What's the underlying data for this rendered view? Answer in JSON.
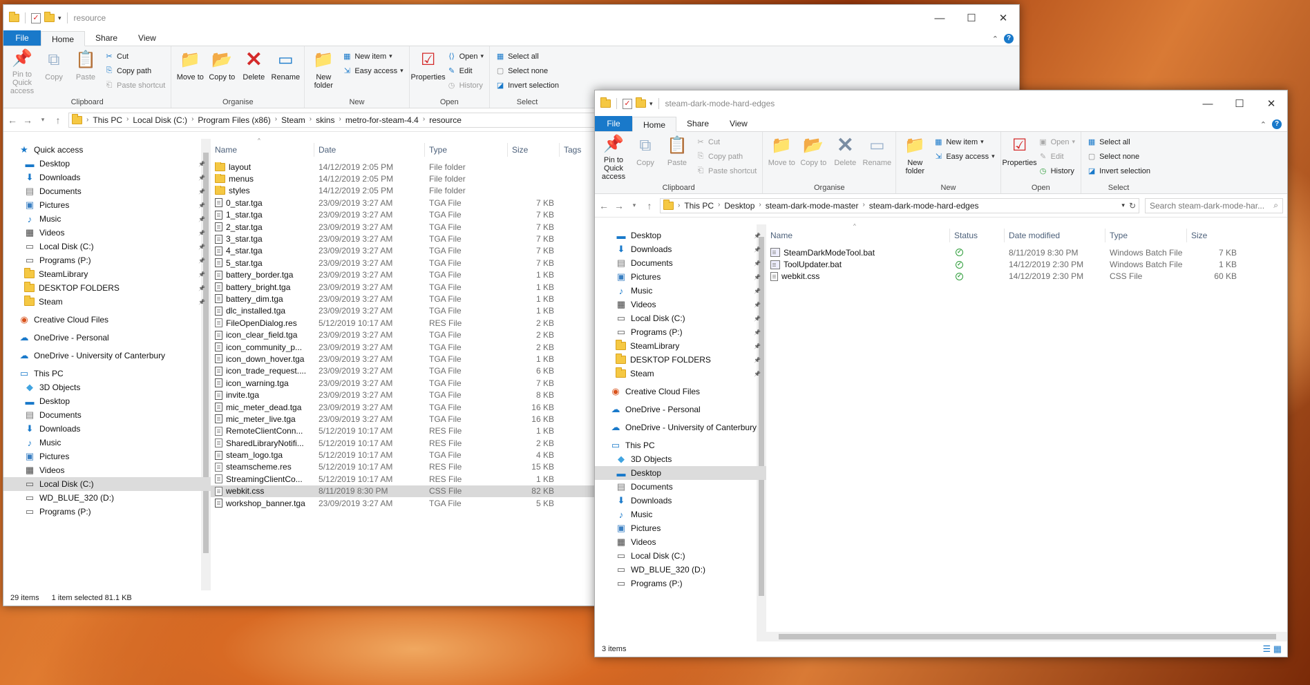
{
  "w1": {
    "title": "resource",
    "tabs": [
      "File",
      "Home",
      "Share",
      "View"
    ],
    "ribbon": {
      "clipboard": {
        "label": "Clipboard",
        "pin": "Pin to Quick access",
        "copy": "Copy",
        "paste": "Paste",
        "cut": "Cut",
        "copy_path": "Copy path",
        "paste_shortcut": "Paste shortcut"
      },
      "organise": {
        "label": "Organise",
        "move": "Move to",
        "copy": "Copy to",
        "delete": "Delete",
        "rename": "Rename"
      },
      "new": {
        "label": "New",
        "new_folder": "New folder",
        "new_item": "New item",
        "easy_access": "Easy access"
      },
      "open": {
        "label": "Open",
        "properties": "Properties",
        "open": "Open",
        "edit": "Edit",
        "history": "History"
      },
      "select": {
        "label": "Select",
        "select_all": "Select all",
        "select_none": "Select none",
        "invert": "Invert selection"
      }
    },
    "breadcrumbs": [
      "This PC",
      "Local Disk (C:)",
      "Program Files (x86)",
      "Steam",
      "skins",
      "metro-for-steam-4.4",
      "resource"
    ],
    "columns": {
      "name": "Name",
      "date": "Date",
      "type": "Type",
      "size": "Size",
      "tags": "Tags"
    },
    "nav": [
      {
        "label": "Quick access",
        "icon": "star-icon",
        "level": 0
      },
      {
        "label": "Desktop",
        "icon": "desktop-icon",
        "level": 1,
        "pin": true
      },
      {
        "label": "Downloads",
        "icon": "download-icon",
        "level": 1,
        "pin": true
      },
      {
        "label": "Documents",
        "icon": "documents-icon",
        "level": 1,
        "pin": true
      },
      {
        "label": "Pictures",
        "icon": "pictures-icon",
        "level": 1,
        "pin": true
      },
      {
        "label": "Music",
        "icon": "music-icon",
        "level": 1,
        "pin": true
      },
      {
        "label": "Videos",
        "icon": "videos-icon",
        "level": 1,
        "pin": true
      },
      {
        "label": "Local Disk (C:)",
        "icon": "drive-icon",
        "level": 1,
        "pin": true
      },
      {
        "label": "Programs (P:)",
        "icon": "drive-icon",
        "level": 1,
        "pin": true
      },
      {
        "label": "SteamLibrary",
        "icon": "folder-icon",
        "level": 1,
        "pin": true
      },
      {
        "label": "DESKTOP FOLDERS",
        "icon": "folder-icon",
        "level": 1,
        "pin": true
      },
      {
        "label": "Steam",
        "icon": "folder-icon",
        "level": 1,
        "pin": true
      },
      {
        "gap": true
      },
      {
        "label": "Creative Cloud Files",
        "icon": "creative-cloud-icon",
        "level": 0
      },
      {
        "gap": true
      },
      {
        "label": "OneDrive - Personal",
        "icon": "onedrive-icon",
        "level": 0
      },
      {
        "gap": true
      },
      {
        "label": "OneDrive - University of Canterbury",
        "icon": "onedrive-icon",
        "level": 0
      },
      {
        "gap": true
      },
      {
        "label": "This PC",
        "icon": "pc-icon",
        "level": 0
      },
      {
        "label": "3D Objects",
        "icon": "3d-objects-icon",
        "level": 1
      },
      {
        "label": "Desktop",
        "icon": "desktop-icon",
        "level": 1
      },
      {
        "label": "Documents",
        "icon": "documents-icon",
        "level": 1
      },
      {
        "label": "Downloads",
        "icon": "download-icon",
        "level": 1
      },
      {
        "label": "Music",
        "icon": "music-icon",
        "level": 1
      },
      {
        "label": "Pictures",
        "icon": "pictures-icon",
        "level": 1
      },
      {
        "label": "Videos",
        "icon": "videos-icon",
        "level": 1
      },
      {
        "label": "Local Disk (C:)",
        "icon": "drive-icon",
        "level": 1,
        "selected": true
      },
      {
        "label": "WD_BLUE_320 (D:)",
        "icon": "drive-icon",
        "level": 1
      },
      {
        "label": "Programs (P:)",
        "icon": "drive-icon",
        "level": 1
      }
    ],
    "files": [
      {
        "name": "layout",
        "date": "14/12/2019 2:05 PM",
        "type": "File folder",
        "size": "",
        "icon": "folder"
      },
      {
        "name": "menus",
        "date": "14/12/2019 2:05 PM",
        "type": "File folder",
        "size": "",
        "icon": "folder"
      },
      {
        "name": "styles",
        "date": "14/12/2019 2:05 PM",
        "type": "File folder",
        "size": "",
        "icon": "folder"
      },
      {
        "name": "0_star.tga",
        "date": "23/09/2019 3:27 AM",
        "type": "TGA File",
        "size": "7 KB",
        "icon": "image"
      },
      {
        "name": "1_star.tga",
        "date": "23/09/2019 3:27 AM",
        "type": "TGA File",
        "size": "7 KB",
        "icon": "image"
      },
      {
        "name": "2_star.tga",
        "date": "23/09/2019 3:27 AM",
        "type": "TGA File",
        "size": "7 KB",
        "icon": "image"
      },
      {
        "name": "3_star.tga",
        "date": "23/09/2019 3:27 AM",
        "type": "TGA File",
        "size": "7 KB",
        "icon": "image"
      },
      {
        "name": "4_star.tga",
        "date": "23/09/2019 3:27 AM",
        "type": "TGA File",
        "size": "7 KB",
        "icon": "image"
      },
      {
        "name": "5_star.tga",
        "date": "23/09/2019 3:27 AM",
        "type": "TGA File",
        "size": "7 KB",
        "icon": "image"
      },
      {
        "name": "battery_border.tga",
        "date": "23/09/2019 3:27 AM",
        "type": "TGA File",
        "size": "1 KB",
        "icon": "image"
      },
      {
        "name": "battery_bright.tga",
        "date": "23/09/2019 3:27 AM",
        "type": "TGA File",
        "size": "1 KB",
        "icon": "image"
      },
      {
        "name": "battery_dim.tga",
        "date": "23/09/2019 3:27 AM",
        "type": "TGA File",
        "size": "1 KB",
        "icon": "image"
      },
      {
        "name": "dlc_installed.tga",
        "date": "23/09/2019 3:27 AM",
        "type": "TGA File",
        "size": "1 KB",
        "icon": "image"
      },
      {
        "name": "FileOpenDialog.res",
        "date": "5/12/2019 10:17 AM",
        "type": "RES File",
        "size": "2 KB",
        "icon": "file"
      },
      {
        "name": "icon_clear_field.tga",
        "date": "23/09/2019 3:27 AM",
        "type": "TGA File",
        "size": "2 KB",
        "icon": "image"
      },
      {
        "name": "icon_community_p...",
        "date": "23/09/2019 3:27 AM",
        "type": "TGA File",
        "size": "2 KB",
        "icon": "image"
      },
      {
        "name": "icon_down_hover.tga",
        "date": "23/09/2019 3:27 AM",
        "type": "TGA File",
        "size": "1 KB",
        "icon": "image"
      },
      {
        "name": "icon_trade_request....",
        "date": "23/09/2019 3:27 AM",
        "type": "TGA File",
        "size": "6 KB",
        "icon": "image"
      },
      {
        "name": "icon_warning.tga",
        "date": "23/09/2019 3:27 AM",
        "type": "TGA File",
        "size": "7 KB",
        "icon": "image"
      },
      {
        "name": "invite.tga",
        "date": "23/09/2019 3:27 AM",
        "type": "TGA File",
        "size": "8 KB",
        "icon": "image"
      },
      {
        "name": "mic_meter_dead.tga",
        "date": "23/09/2019 3:27 AM",
        "type": "TGA File",
        "size": "16 KB",
        "icon": "image"
      },
      {
        "name": "mic_meter_live.tga",
        "date": "23/09/2019 3:27 AM",
        "type": "TGA File",
        "size": "16 KB",
        "icon": "image"
      },
      {
        "name": "RemoteClientConn...",
        "date": "5/12/2019 10:17 AM",
        "type": "RES File",
        "size": "1 KB",
        "icon": "file"
      },
      {
        "name": "SharedLibraryNotifi...",
        "date": "5/12/2019 10:17 AM",
        "type": "RES File",
        "size": "2 KB",
        "icon": "file"
      },
      {
        "name": "steam_logo.tga",
        "date": "5/12/2019 10:17 AM",
        "type": "TGA File",
        "size": "4 KB",
        "icon": "image"
      },
      {
        "name": "steamscheme.res",
        "date": "5/12/2019 10:17 AM",
        "type": "RES File",
        "size": "15 KB",
        "icon": "file"
      },
      {
        "name": "StreamingClientCo...",
        "date": "5/12/2019 10:17 AM",
        "type": "RES File",
        "size": "1 KB",
        "icon": "file"
      },
      {
        "name": "webkit.css",
        "date": "8/11/2019 8:30 PM",
        "type": "CSS File",
        "size": "82 KB",
        "icon": "file",
        "selected": true
      },
      {
        "name": "workshop_banner.tga",
        "date": "23/09/2019 3:27 AM",
        "type": "TGA File",
        "size": "5 KB",
        "icon": "image"
      }
    ],
    "status": {
      "count": "29 items",
      "selection": "1 item selected  81.1 KB"
    }
  },
  "w2": {
    "title": "steam-dark-mode-hard-edges",
    "tabs": [
      "File",
      "Home",
      "Share",
      "View"
    ],
    "ribbon": {
      "clipboard": {
        "label": "Clipboard",
        "pin": "Pin to Quick access",
        "copy": "Copy",
        "paste": "Paste",
        "cut": "Cut",
        "copy_path": "Copy path",
        "paste_shortcut": "Paste shortcut"
      },
      "organise": {
        "label": "Organise",
        "move": "Move to",
        "copy": "Copy to",
        "delete": "Delete",
        "rename": "Rename"
      },
      "new": {
        "label": "New",
        "new_folder": "New folder",
        "new_item": "New item",
        "easy_access": "Easy access"
      },
      "open": {
        "label": "Open",
        "properties": "Properties",
        "open": "Open",
        "edit": "Edit",
        "history": "History"
      },
      "select": {
        "label": "Select",
        "select_all": "Select all",
        "select_none": "Select none",
        "invert": "Invert selection"
      }
    },
    "breadcrumbs": [
      "This PC",
      "Desktop",
      "steam-dark-mode-master",
      "steam-dark-mode-hard-edges"
    ],
    "search_placeholder": "Search steam-dark-mode-har...",
    "columns": {
      "name": "Name",
      "status": "Status",
      "date": "Date modified",
      "type": "Type",
      "size": "Size"
    },
    "nav": [
      {
        "label": "Desktop",
        "icon": "desktop-icon",
        "level": 1,
        "pin": true
      },
      {
        "label": "Downloads",
        "icon": "download-icon",
        "level": 1,
        "pin": true
      },
      {
        "label": "Documents",
        "icon": "documents-icon",
        "level": 1,
        "pin": true
      },
      {
        "label": "Pictures",
        "icon": "pictures-icon",
        "level": 1,
        "pin": true
      },
      {
        "label": "Music",
        "icon": "music-icon",
        "level": 1,
        "pin": true
      },
      {
        "label": "Videos",
        "icon": "videos-icon",
        "level": 1,
        "pin": true
      },
      {
        "label": "Local Disk (C:)",
        "icon": "drive-icon",
        "level": 1,
        "pin": true
      },
      {
        "label": "Programs (P:)",
        "icon": "drive-icon",
        "level": 1,
        "pin": true
      },
      {
        "label": "SteamLibrary",
        "icon": "folder-icon",
        "level": 1,
        "pin": true
      },
      {
        "label": "DESKTOP FOLDERS",
        "icon": "folder-icon",
        "level": 1,
        "pin": true
      },
      {
        "label": "Steam",
        "icon": "folder-icon",
        "level": 1,
        "pin": true
      },
      {
        "gap": true
      },
      {
        "label": "Creative Cloud Files",
        "icon": "creative-cloud-icon",
        "level": 0
      },
      {
        "gap": true
      },
      {
        "label": "OneDrive - Personal",
        "icon": "onedrive-icon",
        "level": 0
      },
      {
        "gap": true
      },
      {
        "label": "OneDrive - University of Canterbury",
        "icon": "onedrive-icon",
        "level": 0
      },
      {
        "gap": true
      },
      {
        "label": "This PC",
        "icon": "pc-icon",
        "level": 0
      },
      {
        "label": "3D Objects",
        "icon": "3d-objects-icon",
        "level": 1
      },
      {
        "label": "Desktop",
        "icon": "desktop-icon",
        "level": 1,
        "selected": true
      },
      {
        "label": "Documents",
        "icon": "documents-icon",
        "level": 1
      },
      {
        "label": "Downloads",
        "icon": "download-icon",
        "level": 1
      },
      {
        "label": "Music",
        "icon": "music-icon",
        "level": 1
      },
      {
        "label": "Pictures",
        "icon": "pictures-icon",
        "level": 1
      },
      {
        "label": "Videos",
        "icon": "videos-icon",
        "level": 1
      },
      {
        "label": "Local Disk (C:)",
        "icon": "drive-icon",
        "level": 1
      },
      {
        "label": "WD_BLUE_320 (D:)",
        "icon": "drive-icon",
        "level": 1
      },
      {
        "label": "Programs (P:)",
        "icon": "drive-icon",
        "level": 1
      }
    ],
    "files": [
      {
        "name": "SteamDarkModeTool.bat",
        "date": "8/11/2019 8:30 PM",
        "type": "Windows Batch File",
        "size": "7 KB",
        "icon": "batch"
      },
      {
        "name": "ToolUpdater.bat",
        "date": "14/12/2019 2:30 PM",
        "type": "Windows Batch File",
        "size": "1 KB",
        "icon": "batch"
      },
      {
        "name": "webkit.css",
        "date": "14/12/2019 2:30 PM",
        "type": "CSS File",
        "size": "60 KB",
        "icon": "file"
      }
    ],
    "status": {
      "count": "3 items"
    }
  },
  "colors": {
    "accent": "#1979ca",
    "folder": "#f5c843",
    "delete": "#d42a2a",
    "ok": "#2e9d3a"
  }
}
